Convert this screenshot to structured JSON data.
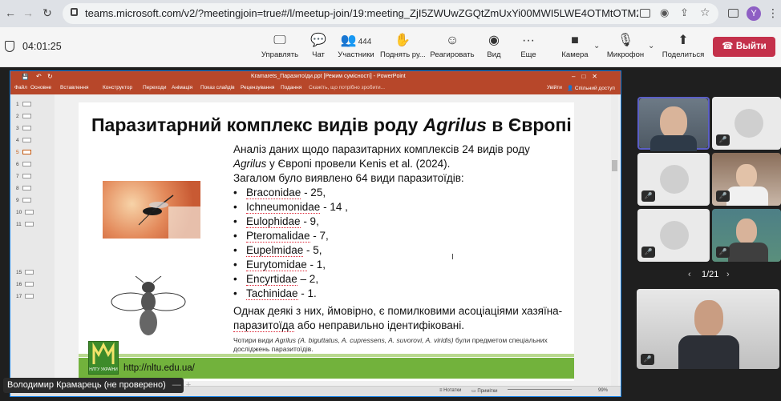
{
  "browser": {
    "url": "teams.microsoft.com/v2/?meetingjoin=true#/l/meetup-join/19:meeting_ZjI5ZWUwZGQtZmUxYi00MWI5LWE4OTMtOTM2ZTQyNjI3YT...",
    "profile_initial": "Y"
  },
  "teams": {
    "timer": "04:01:25",
    "toolbar": {
      "manage": "Управлять",
      "chat": "Чат",
      "people": "Участники",
      "people_count": "444",
      "raise": "Поднять ру...",
      "react": "Реагировать",
      "view": "Вид",
      "more": "Еще",
      "camera": "Камера",
      "mic": "Микрофон",
      "share": "Поделиться",
      "leave": "Выйти"
    }
  },
  "ppt": {
    "window_title": "Kramarets_Паразитоїди.ppt [Режим сумісності] - PowerPoint",
    "ribbon_tabs": [
      "Файл",
      "Основне",
      "Вставлення",
      "Конструктор",
      "Переходи",
      "Анімація",
      "Показ слайдів",
      "Рецензування",
      "Подання"
    ],
    "tell_me": "Скажіть, що потрібно зробити...",
    "sign_in": "Увійти",
    "share_btn": "Спільний доступ",
    "thumbs": [
      "1",
      "2",
      "3",
      "4",
      "5",
      "6",
      "7",
      "8",
      "9",
      "10",
      "11",
      "15",
      "16",
      "17"
    ],
    "status": {
      "notes": "Нотатки",
      "comments": "Примітки",
      "zoom": "99%"
    }
  },
  "slide": {
    "title_pre": "Паразитарний комплекс видів роду ",
    "title_genus": "Agrilus",
    "title_post": " в Європі",
    "intro_1": "Аналіз даних щодо паразитарних комплексів 24 видів роду ",
    "intro_genus": "Agrilus",
    "intro_2": " у Європі провели Kenis et al. (2024).",
    "intro_3": "Загалом було виявлено 64 види паразитоїдів:",
    "families": [
      {
        "name": "Braconidae",
        "count": " - 25,"
      },
      {
        "name": "Ichneumonidae",
        "count": " - 14 ,"
      },
      {
        "name": "Eulophidae",
        "count": " - 9,"
      },
      {
        "name": "Pteromalidae",
        "count": " - 7,"
      },
      {
        "name": "Eupelmidae",
        "count": " - 5,"
      },
      {
        "name": "Eurytomidae",
        "count": " - 1,"
      },
      {
        "name": "Encyrtidae",
        "count": " – 2,"
      },
      {
        "name": "Tachinidae",
        "count": " - 1."
      }
    ],
    "conclusion_1": "Однак деякі з них, ймовірно, є помилковими асоціаціями хазяїна-",
    "conclusion_u": "паразитоїда",
    "conclusion_2": " або неправильно ідентифіковані.",
    "footnote_1": "Чотири види ",
    "footnote_sp": "Agrilus (A. biguttatus, A. cupressens, A. suvorovi, A. viridis)",
    "footnote_2": " були предметом спеціальних досліджень паразитоїдів.",
    "url": "http://nltu.edu.ua/",
    "logo_text": "НЛТУ УКРАЇНИ"
  },
  "participants": {
    "pager": "1/21",
    "speaker_name": "Володимир Крамарець (не проверено)"
  }
}
